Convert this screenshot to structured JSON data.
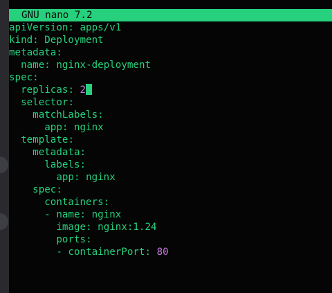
{
  "titlebar": {
    "text": "GNU nano 7.2"
  },
  "lines": [
    {
      "indent": "",
      "key": "apiVersion",
      "sep": ": ",
      "value": "apps/v1",
      "type": "str"
    },
    {
      "indent": "",
      "key": "kind",
      "sep": ": ",
      "value": "Deployment",
      "type": "str"
    },
    {
      "indent": "",
      "key": "metadata",
      "sep": ":",
      "value": "",
      "type": "str"
    },
    {
      "indent": "  ",
      "key": "name",
      "sep": ": ",
      "value": "nginx-deployment",
      "type": "str"
    },
    {
      "indent": "",
      "key": "spec",
      "sep": ":",
      "value": "",
      "type": "str"
    },
    {
      "indent": "  ",
      "key": "replicas",
      "sep": ": ",
      "value": "2",
      "type": "num",
      "cursor": true
    },
    {
      "indent": "  ",
      "key": "selector",
      "sep": ":",
      "value": "",
      "type": "str"
    },
    {
      "indent": "    ",
      "key": "matchLabels",
      "sep": ":",
      "value": "",
      "type": "str"
    },
    {
      "indent": "      ",
      "key": "app",
      "sep": ": ",
      "value": "nginx",
      "type": "str"
    },
    {
      "indent": "  ",
      "key": "template",
      "sep": ":",
      "value": "",
      "type": "str"
    },
    {
      "indent": "    ",
      "key": "metadata",
      "sep": ":",
      "value": "",
      "type": "str"
    },
    {
      "indent": "      ",
      "key": "labels",
      "sep": ":",
      "value": "",
      "type": "str"
    },
    {
      "indent": "        ",
      "key": "app",
      "sep": ": ",
      "value": "nginx",
      "type": "str"
    },
    {
      "indent": "    ",
      "key": "spec",
      "sep": ":",
      "value": "",
      "type": "str"
    },
    {
      "indent": "      ",
      "key": "containers",
      "sep": ":",
      "value": "",
      "type": "str"
    },
    {
      "indent": "      - ",
      "key": "name",
      "sep": ": ",
      "value": "nginx",
      "type": "str"
    },
    {
      "indent": "        ",
      "key": "image",
      "sep": ": ",
      "value": "nginx:1.24",
      "type": "str"
    },
    {
      "indent": "        ",
      "key": "ports",
      "sep": ":",
      "value": "",
      "type": "str"
    },
    {
      "indent": "        - ",
      "key": "containerPort",
      "sep": ": ",
      "value": "80",
      "type": "num"
    }
  ]
}
